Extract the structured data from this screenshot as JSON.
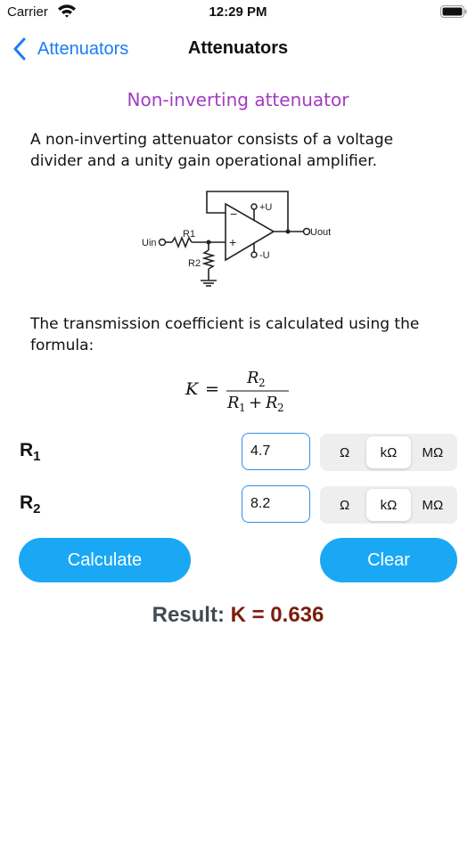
{
  "status_bar": {
    "carrier": "Carrier",
    "time": "12:29 PM"
  },
  "nav": {
    "back_label": "Attenuators",
    "title": "Attenuators"
  },
  "heading": "Non-inverting attenuator",
  "description": "A non-inverting attenuator consists of a voltage divider and a unity gain operational amplifier.",
  "circuit": {
    "labels": {
      "plus_supply": "+U",
      "minus_supply": "-U",
      "output": "Uout",
      "input": "Uin",
      "r1": "R1",
      "r2": "R2",
      "minus_sign": "−",
      "plus_sign": "+"
    }
  },
  "formula_text": "The transmission coefficient is calculated using the formula:",
  "formula": {
    "lhs": "K",
    "eq": "=",
    "num": "R",
    "num_sub": "2",
    "den_a": "R",
    "den_a_sub": "1",
    "den_plus": "+",
    "den_b": "R",
    "den_b_sub": "2"
  },
  "inputs": [
    {
      "label": "R",
      "label_sub": "1",
      "value": "4.7",
      "units": [
        "Ω",
        "kΩ",
        "MΩ"
      ],
      "selected_unit": "kΩ"
    },
    {
      "label": "R",
      "label_sub": "2",
      "value": "8.2",
      "units": [
        "Ω",
        "kΩ",
        "MΩ"
      ],
      "selected_unit": "kΩ"
    }
  ],
  "buttons": {
    "calculate": "Calculate",
    "clear": "Clear"
  },
  "result": {
    "label": "Result:",
    "value": "K = 0.636"
  },
  "colors": {
    "accent_blue": "#1a7cf5",
    "button_blue": "#1aa8f5",
    "heading_purple": "#a23cc0",
    "result_red": "#7a1e0c"
  }
}
